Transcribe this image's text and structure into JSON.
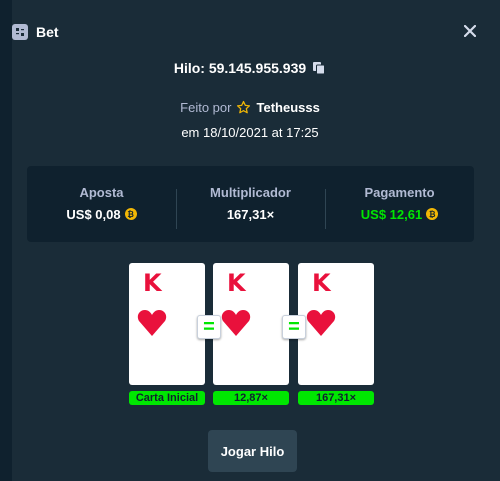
{
  "modal": {
    "title": "Bet",
    "game_id": "Hilo: 59.145.955.939",
    "made_by_prefix": "Feito por",
    "username": "Tetheusss",
    "date": "em 18/10/2021 at 17:25"
  },
  "stats": {
    "bet_label": "Aposta",
    "bet_value": "US$ 0,08",
    "multiplier_label": "Multiplicador",
    "multiplier_value": "167,31×",
    "payout_label": "Pagamento",
    "payout_value": "US$ 12,61"
  },
  "cards": [
    {
      "rank": "K",
      "suit": "heart",
      "tag": "Carta Inicial"
    },
    {
      "rank": "K",
      "suit": "heart",
      "tag": "12,87×"
    },
    {
      "rank": "K",
      "suit": "heart",
      "tag": "167,31×"
    }
  ],
  "equals_symbol": "=",
  "coin_symbol": "₿",
  "play_button_label": "Jogar Hilo",
  "colors": {
    "background": "#1a2c38",
    "panel": "#0f212e",
    "accent_green": "#00e701",
    "card_red": "#e9113c",
    "button": "#2f4553",
    "coin": "#f2b705"
  },
  "icons": {
    "header": "bet-slip-icon",
    "close": "close-icon",
    "copy": "copy-icon",
    "user": "star-icon",
    "currency": "coin-icon"
  }
}
